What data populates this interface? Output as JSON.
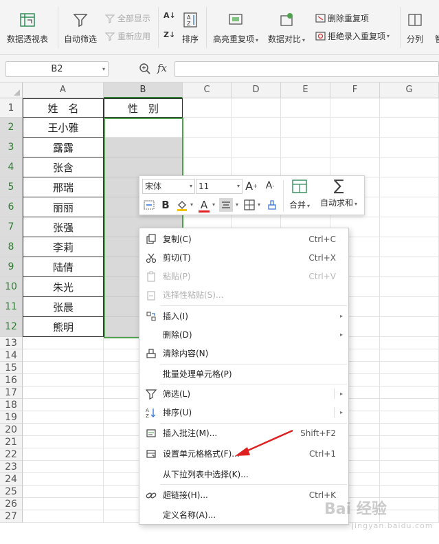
{
  "ribbon": {
    "pivot_label": "数据透视表",
    "autofilter_label": "自动筛选",
    "show_all_label": "全部显示",
    "reapply_label": "重新应用",
    "sort_label": "排序",
    "highlight_dup_label": "高亮重复项",
    "compare_label": "数据对比",
    "remove_dup_label": "删除重复项",
    "reject_dup_label": "拒绝录入重复项",
    "split_label": "分列",
    "smart_label": "智"
  },
  "formula_bar": {
    "name_box": "B2",
    "fx_label": "fx",
    "formula_value": ""
  },
  "grid": {
    "columns": [
      "A",
      "B",
      "C",
      "D",
      "E",
      "F",
      "G"
    ],
    "rows": [
      "1",
      "2",
      "3",
      "4",
      "5",
      "6",
      "7",
      "8",
      "9",
      "10",
      "11",
      "12",
      "13",
      "14",
      "15",
      "16",
      "17",
      "18",
      "19",
      "20",
      "21",
      "22",
      "23",
      "24",
      "25",
      "26",
      "27"
    ],
    "header_a": "姓　名",
    "header_b": "性　别",
    "names": [
      "王小雅",
      "露露",
      "张含",
      "邢瑞",
      "丽丽",
      "张强",
      "李莉",
      "陆倩",
      "朱光",
      "张晨",
      "熊明"
    ]
  },
  "mini_toolbar": {
    "font_name": "宋体",
    "font_size": "11",
    "grow_font": "A",
    "shrink_font": "A",
    "bold": "B",
    "font_color": "A",
    "merge_label": "合并",
    "autosum_label": "自动求和"
  },
  "context_menu": {
    "copy": {
      "label": "复制(C)",
      "shortcut": "Ctrl+C"
    },
    "cut": {
      "label": "剪切(T)",
      "shortcut": "Ctrl+X"
    },
    "paste": {
      "label": "粘贴(P)",
      "shortcut": "Ctrl+V"
    },
    "paste_special": {
      "label": "选择性粘贴(S)..."
    },
    "insert": {
      "label": "插入(I)"
    },
    "delete": {
      "label": "删除(D)"
    },
    "clear": {
      "label": "清除内容(N)"
    },
    "batch": {
      "label": "批量处理单元格(P)"
    },
    "filter": {
      "label": "筛选(L)"
    },
    "sort": {
      "label": "排序(U)"
    },
    "comment": {
      "label": "插入批注(M)...",
      "shortcut": "Shift+F2"
    },
    "format_cells": {
      "label": "设置单元格格式(F)...",
      "shortcut": "Ctrl+1"
    },
    "pick_list": {
      "label": "从下拉列表中选择(K)..."
    },
    "hyperlink": {
      "label": "超链接(H)...",
      "shortcut": "Ctrl+K"
    },
    "define_name": {
      "label": "定义名称(A)..."
    }
  },
  "watermark": {
    "text": "Bai 经验",
    "sub": "jingyan.baidu.com"
  },
  "colors": {
    "accent_green": "#4ea24e",
    "selection_gray": "#d9d9d9",
    "arrow_red": "#e02020"
  }
}
